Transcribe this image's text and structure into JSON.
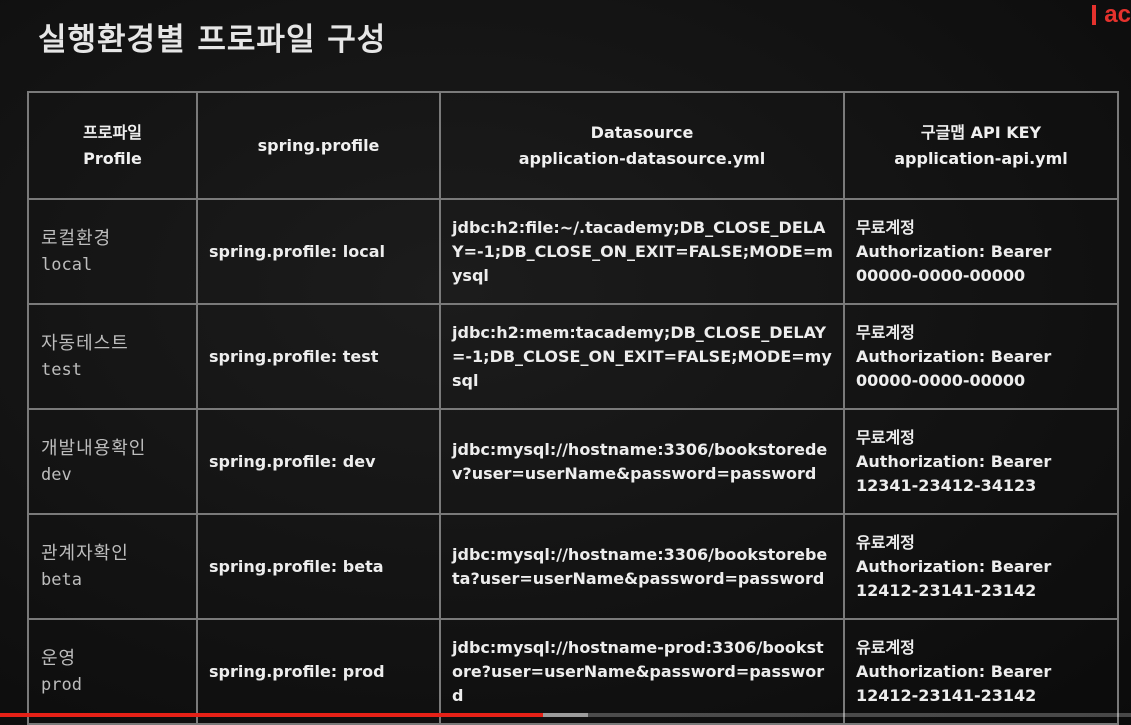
{
  "slide": {
    "title": "실행환경별 프로파일 구성"
  },
  "brand": {
    "text": "ac",
    "color": "#e5322d"
  },
  "table": {
    "headers": {
      "profile": [
        "프로파일",
        "Profile"
      ],
      "spring": [
        "spring.profile"
      ],
      "datasource": [
        "Datasource",
        "application-datasource.yml"
      ],
      "apikey": [
        "구글맵 API KEY",
        "application-api.yml"
      ]
    },
    "rows": [
      {
        "env_ko": "로컬환경",
        "env_en": "local",
        "profile": "spring.profile: local",
        "datasource": "jdbc:h2:file:~/.tacademy;DB_CLOSE_DELAY=-1;DB_CLOSE_ON_EXIT=FALSE;MODE=mysql",
        "account": "무료계정",
        "auth": "Authorization: Bearer",
        "key": "00000-0000-00000"
      },
      {
        "env_ko": "자동테스트",
        "env_en": "test",
        "profile": "spring.profile: test",
        "datasource": "jdbc:h2:mem:tacademy;DB_CLOSE_DELAY=-1;DB_CLOSE_ON_EXIT=FALSE;MODE=mysql",
        "account": "무료계정",
        "auth": "Authorization: Bearer",
        "key": "00000-0000-00000"
      },
      {
        "env_ko": "개발내용확인",
        "env_en": "dev",
        "profile": "spring.profile: dev",
        "datasource": "jdbc:mysql://hostname:3306/bookstoredev?user=userName&password=password",
        "account": "무료계정",
        "auth": "Authorization: Bearer",
        "key": "12341-23412-34123"
      },
      {
        "env_ko": "관계자확인",
        "env_en": "beta",
        "profile": "spring.profile: beta",
        "datasource": "jdbc:mysql://hostname:3306/bookstorebeta?user=userName&password=password",
        "account": "유료계정",
        "auth": "Authorization: Bearer",
        "key": "12412-23141-23142"
      },
      {
        "env_ko": "운영",
        "env_en": "prod",
        "profile": "spring.profile: prod",
        "datasource": "jdbc:mysql://hostname-prod:3306/bookstore?user=userName&password=password",
        "account": "유료계정",
        "auth": "Authorization: Bearer",
        "key": "12412-23141-23142"
      }
    ]
  },
  "player": {
    "progress": 0.48,
    "progress_color": "#e62117"
  }
}
